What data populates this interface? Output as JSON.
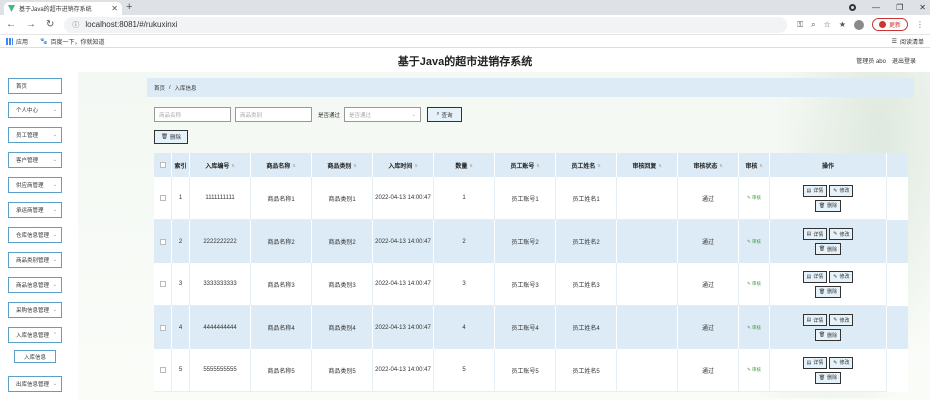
{
  "browser": {
    "tab_title": "基于Java的超市进销存系统",
    "url": "localhost:8081/#/rukuxinxi",
    "update_label": "更新",
    "bookmarks": [
      "应用",
      "百度一下，你就知道"
    ],
    "reading_list": "阅读清单"
  },
  "app": {
    "title": "基于Java的超市进销存系统",
    "user_label": "管理员 abo",
    "logout_label": "退出登录"
  },
  "sidebar": {
    "items": [
      "首页",
      "个人中心",
      "员工管理",
      "客户管理",
      "供应商管理",
      "承运商管理",
      "仓库信息管理",
      "商品类别管理",
      "商品信息管理",
      "采购信息管理",
      "入库信息管理",
      "出库信息管理"
    ],
    "sub_item": "入库信息"
  },
  "breadcrumb": {
    "home": "首页",
    "sep": "/",
    "current": "入库信息"
  },
  "search": {
    "name_placeholder": "商品名称",
    "type_placeholder": "商品类别",
    "status_label": "是否通过",
    "status_placeholder": "是否通过",
    "query_label": "查询"
  },
  "toolbar": {
    "delete_label": "删除"
  },
  "table": {
    "headers": [
      "索引",
      "入库编号",
      "商品名称",
      "商品类别",
      "入库时间",
      "数量",
      "员工账号",
      "员工姓名",
      "审核回复",
      "审核状态",
      "审核",
      "操作"
    ],
    "rows": [
      {
        "idx": "1",
        "no": "1111111111",
        "name": "商品名称1",
        "type": "商品类别1",
        "time": "2022-04-13 14:00:47",
        "qty": "1",
        "acc": "员工账号1",
        "emp": "员工姓名1",
        "reply": "",
        "status": "通过",
        "audit": "审核"
      },
      {
        "idx": "2",
        "no": "2222222222",
        "name": "商品名称2",
        "type": "商品类别2",
        "time": "2022-04-13 14:00:47",
        "qty": "2",
        "acc": "员工账号2",
        "emp": "员工姓名2",
        "reply": "",
        "status": "通过",
        "audit": "审核"
      },
      {
        "idx": "3",
        "no": "3333333333",
        "name": "商品名称3",
        "type": "商品类别3",
        "time": "2022-04-13 14:00:47",
        "qty": "3",
        "acc": "员工账号3",
        "emp": "员工姓名3",
        "reply": "",
        "status": "通过",
        "audit": "审核"
      },
      {
        "idx": "4",
        "no": "4444444444",
        "name": "商品名称4",
        "type": "商品类别4",
        "time": "2022-04-13 14:00:47",
        "qty": "4",
        "acc": "员工账号4",
        "emp": "员工姓名4",
        "reply": "",
        "status": "通过",
        "audit": "审核"
      },
      {
        "idx": "5",
        "no": "5555555555",
        "name": "商品名称5",
        "type": "商品类别5",
        "time": "2022-04-13 14:00:47",
        "qty": "5",
        "acc": "员工账号5",
        "emp": "员工姓名5",
        "reply": "",
        "status": "通过",
        "audit": "审核"
      }
    ],
    "ops": {
      "detail": "详情",
      "edit": "修改",
      "delete": "删除"
    }
  }
}
